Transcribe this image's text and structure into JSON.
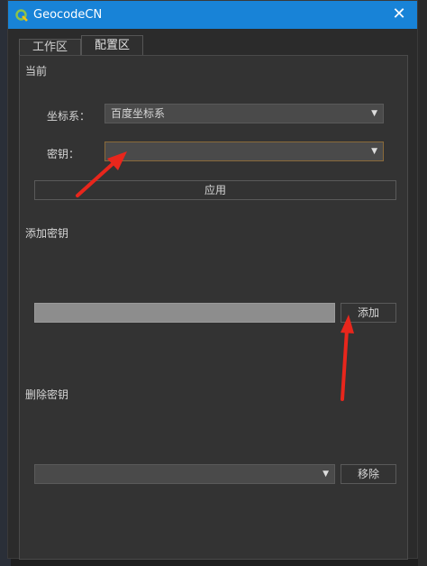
{
  "window": {
    "title": "GeocodeCN",
    "close_glyph": "✕"
  },
  "tabs": [
    {
      "label": "工作区"
    },
    {
      "label": "配置区"
    }
  ],
  "current": {
    "heading": "当前",
    "crs_label": "坐标系：",
    "crs_value": "百度坐标系",
    "key_label": "密钥：",
    "key_value": "",
    "apply_label": "应用"
  },
  "add_key": {
    "heading": "添加密钥",
    "input_value": "",
    "button_label": "添加"
  },
  "delete_key": {
    "heading": "删除密钥",
    "select_value": "",
    "button_label": "移除"
  },
  "colors": {
    "titlebar": "#1883d7",
    "annotation_arrow": "#e8261c"
  },
  "icons": {
    "app": "qgis-icon",
    "dropdown": "chevron-down-icon"
  }
}
